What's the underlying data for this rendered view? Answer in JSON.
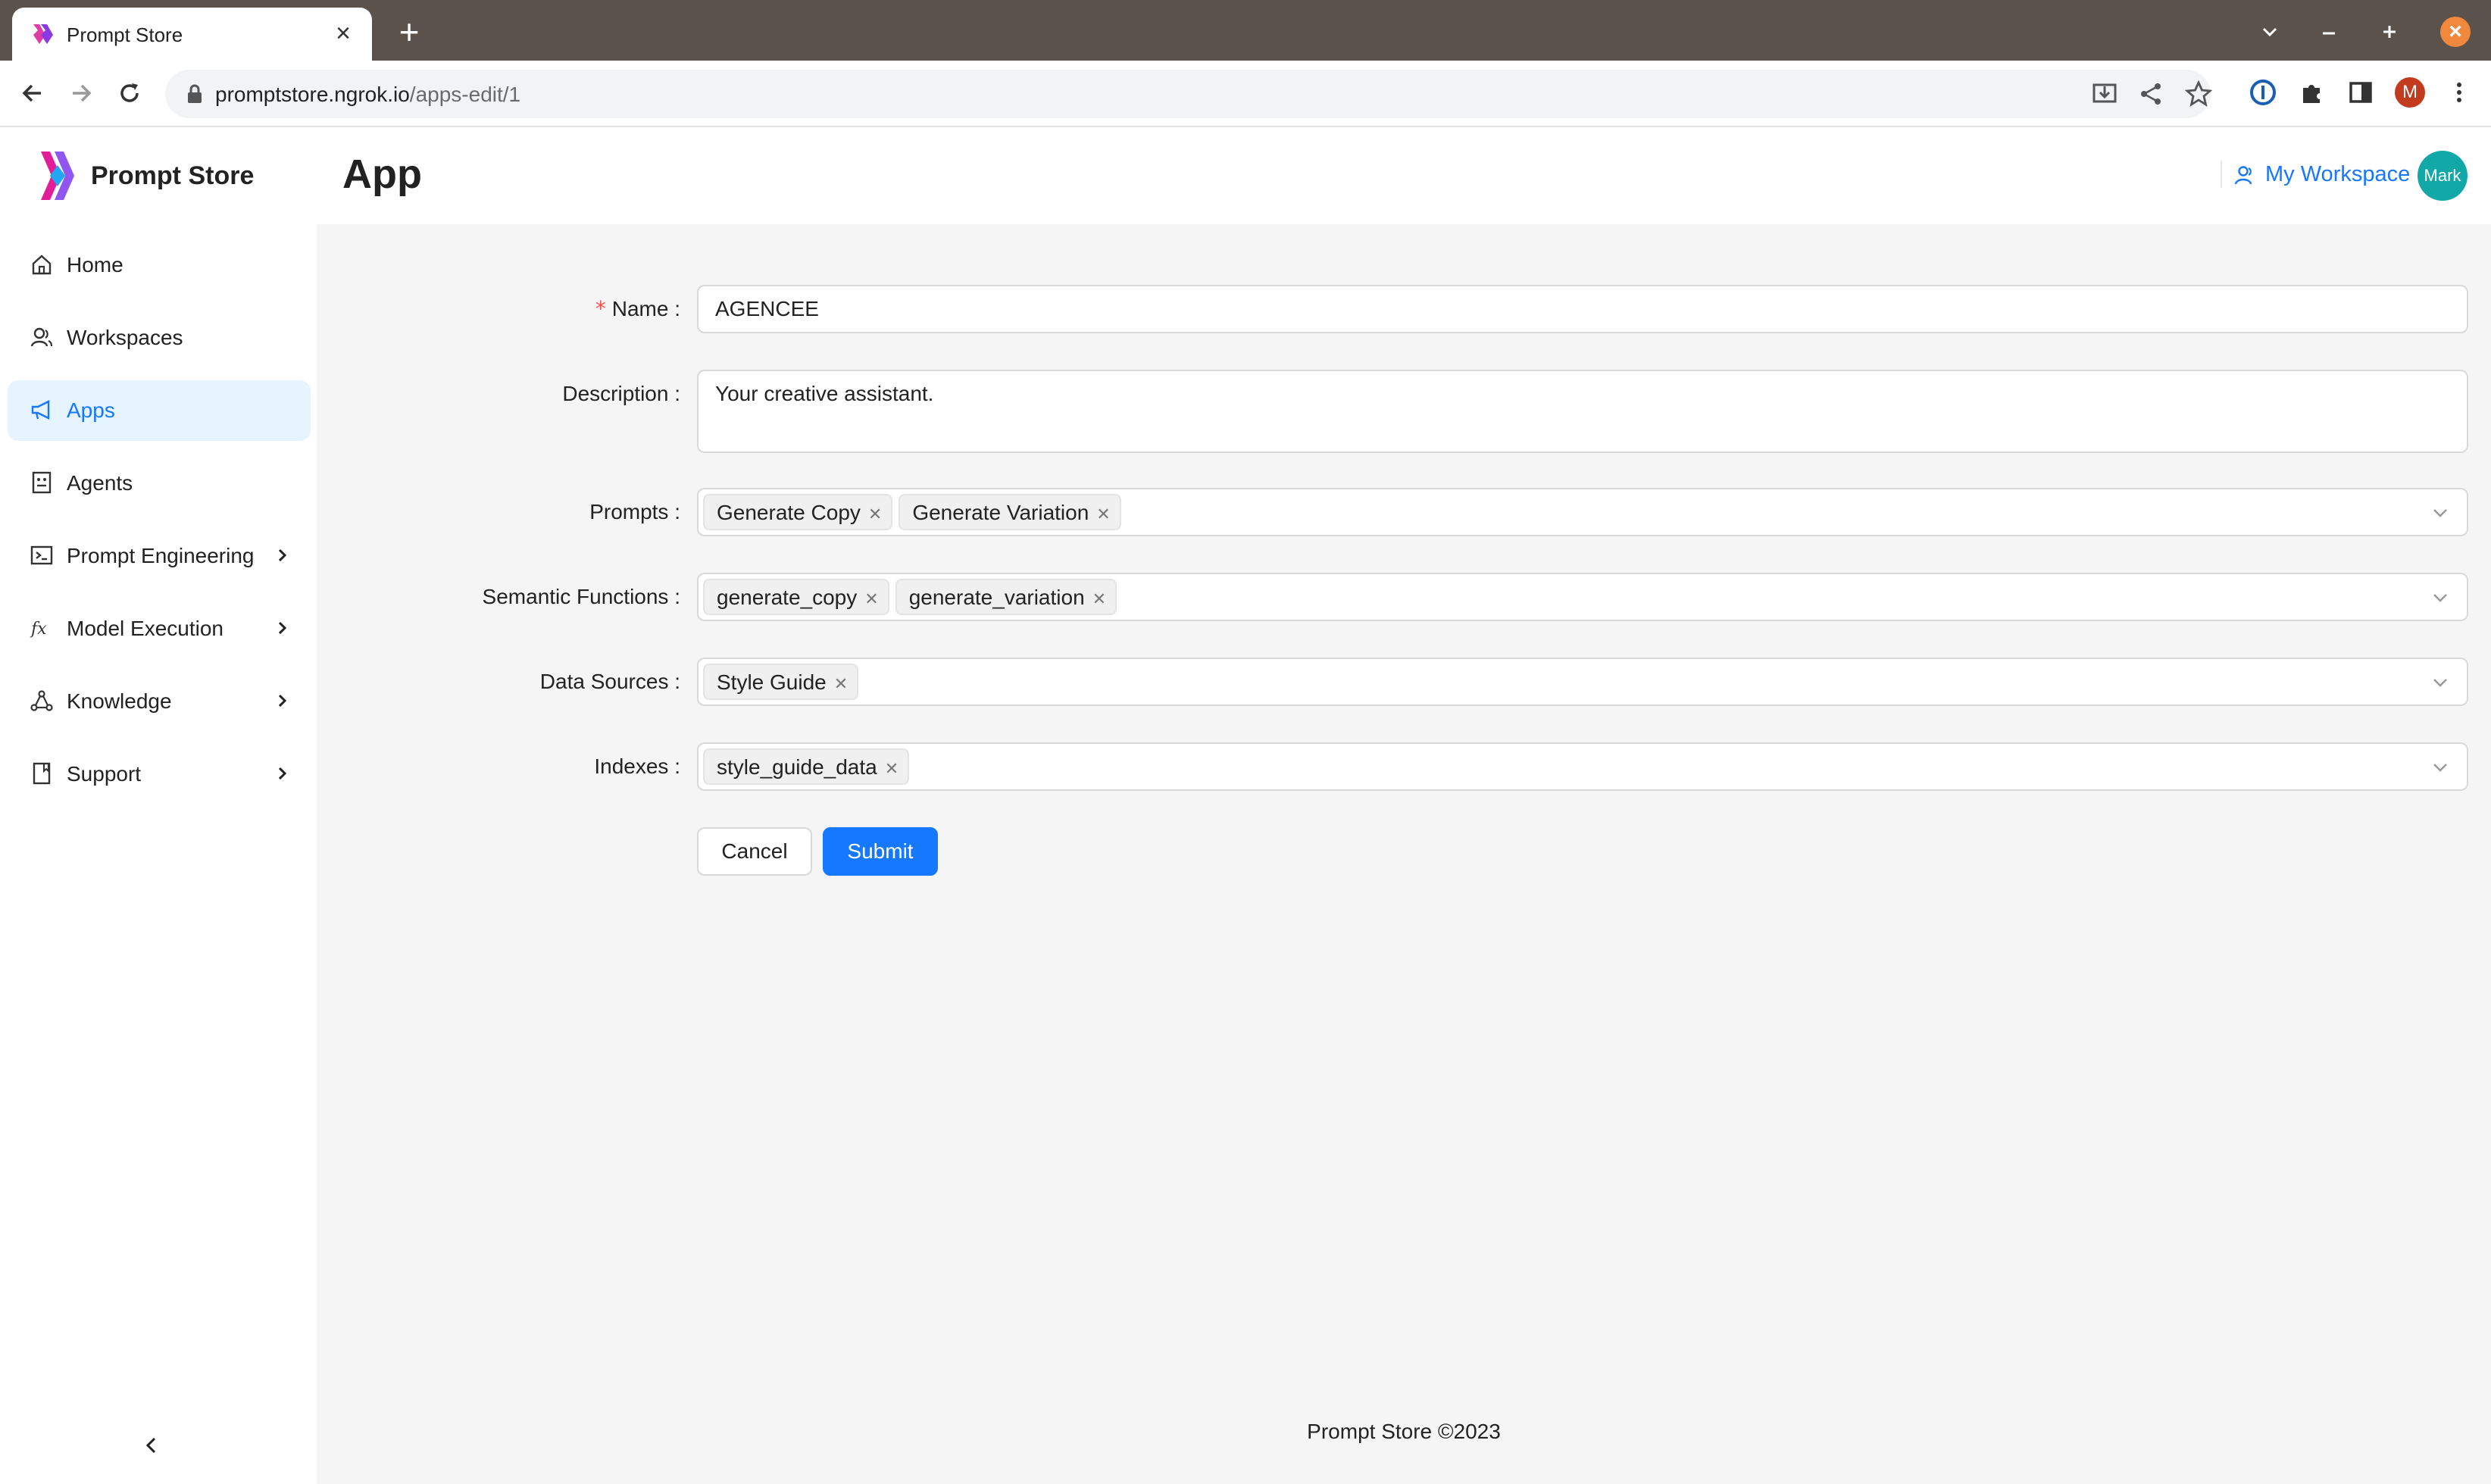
{
  "browser": {
    "tab_title": "Prompt Store",
    "url_host": "promptstore.ngrok.io",
    "url_path": "/apps-edit/1",
    "profile_initial": "M"
  },
  "app": {
    "brand": "Prompt Store",
    "page_title": "App",
    "workspace_label": "My Workspace",
    "avatar_text": "Mark",
    "accent": "#1677ff"
  },
  "sidebar": {
    "items": [
      {
        "label": "Home",
        "icon": "home-icon",
        "active": false
      },
      {
        "label": "Workspaces",
        "icon": "workspaces-icon",
        "active": false
      },
      {
        "label": "Apps",
        "icon": "megaphone-icon",
        "active": true
      },
      {
        "label": "Agents",
        "icon": "agent-icon",
        "active": false
      },
      {
        "label": "Prompt Engineering",
        "icon": "terminal-icon",
        "active": false,
        "expandable": true
      },
      {
        "label": "Model Execution",
        "icon": "fx-icon",
        "active": false,
        "expandable": true
      },
      {
        "label": "Knowledge",
        "icon": "network-icon",
        "active": false,
        "expandable": true
      },
      {
        "label": "Support",
        "icon": "book-icon",
        "active": false,
        "expandable": true
      }
    ]
  },
  "form": {
    "name": {
      "label": "Name",
      "required": true,
      "value": "AGENCEE"
    },
    "description": {
      "label": "Description",
      "value": "Your creative assistant."
    },
    "prompts": {
      "label": "Prompts",
      "tags": [
        "Generate Copy",
        "Generate Variation"
      ]
    },
    "semantic_functions": {
      "label": "Semantic Functions",
      "tags": [
        "generate_copy",
        "generate_variation"
      ]
    },
    "data_sources": {
      "label": "Data Sources",
      "tags": [
        "Style Guide"
      ]
    },
    "indexes": {
      "label": "Indexes",
      "tags": [
        "style_guide_data"
      ]
    },
    "cancel_label": "Cancel",
    "submit_label": "Submit"
  },
  "footer": {
    "text": "Prompt Store ©2023"
  }
}
